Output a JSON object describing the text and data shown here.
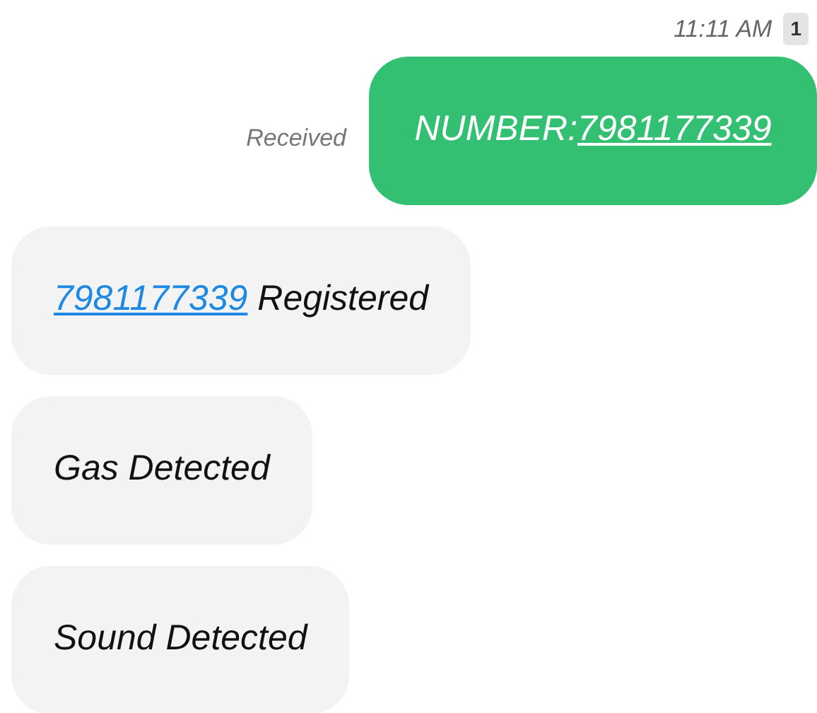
{
  "header": {
    "time": "11:11 AM",
    "sim": "1"
  },
  "messages": [
    {
      "kind": "sent",
      "status": "Received",
      "parts": [
        {
          "kind": "text",
          "text": "NUMBER:"
        },
        {
          "kind": "link",
          "text": "7981177339"
        }
      ]
    },
    {
      "kind": "received",
      "parts": [
        {
          "kind": "link",
          "text": "7981177339"
        },
        {
          "kind": "text",
          "text": " Registered"
        }
      ]
    },
    {
      "kind": "received",
      "parts": [
        {
          "kind": "text",
          "text": "Gas Detected"
        }
      ]
    },
    {
      "kind": "received",
      "parts": [
        {
          "kind": "text",
          "text": "Sound Detected"
        }
      ]
    }
  ]
}
